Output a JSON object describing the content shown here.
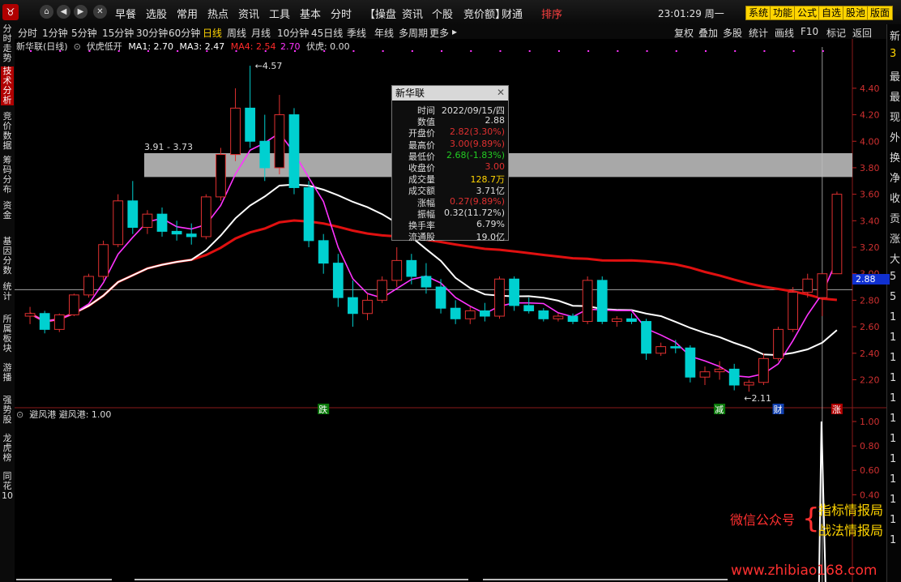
{
  "menu": {
    "items": [
      "早餐",
      "选股",
      "常用",
      "热点",
      "资讯",
      "工具",
      "基本",
      "分时",
      "【操盘",
      "资讯",
      "个股",
      "竞价额】",
      "财通",
      "排序"
    ],
    "clock": "23:01:29 周一",
    "sys_buttons": [
      "系统",
      "功能",
      "公式",
      "自选",
      "股池",
      "版面"
    ]
  },
  "periods": [
    "分时",
    "1分钟",
    "5分钟",
    "15分钟",
    "30分钟",
    "60分钟",
    "日线",
    "周线",
    "月线",
    "10分钟",
    "45日线",
    "季线",
    "年线",
    "多周期",
    "更多"
  ],
  "active_period": "日线",
  "tools": [
    "复权",
    "叠加",
    "多股",
    "统计",
    "画线",
    "F10",
    "标记",
    "返回"
  ],
  "sidebar": [
    "分时走势",
    "技术分析",
    "竞价数据",
    "筹码分布",
    "资金",
    "基因分数",
    "统计",
    "所属板块",
    "游播",
    "强势股",
    "龙虎榜",
    "同花10"
  ],
  "legend": {
    "name": "新华联(日线)",
    "indicator": "伏虎低开",
    "ma1": "MA1: 2.70",
    "ma3": "MA3: 2.47",
    "ma4": "MA4: 2.54",
    "ma4b": "2.70",
    "fuhu": "伏虎: 0.00"
  },
  "sub_legend": "避风港 避风港: 1.00",
  "tooltip": {
    "title": "新华联",
    "rows": [
      {
        "label": "时间",
        "value": "2022/09/15/四",
        "color": "#dddddd"
      },
      {
        "label": "数值",
        "value": "2.88",
        "color": "#dddddd"
      },
      {
        "label": "开盘价",
        "value": "2.82(3.30%)",
        "color": "#e03030"
      },
      {
        "label": "最高价",
        "value": "3.00(9.89%)",
        "color": "#e03030"
      },
      {
        "label": "最低价",
        "value": "2.68(-1.83%)",
        "color": "#22cc22"
      },
      {
        "label": "收盘价",
        "value": "3.00",
        "color": "#e03030"
      },
      {
        "label": "成交量",
        "value": "128.7万",
        "color": "#ffd400"
      },
      {
        "label": "成交额",
        "value": "3.71亿",
        "color": "#dddddd"
      },
      {
        "label": "涨幅",
        "value": "0.27(9.89%)",
        "color": "#e03030"
      },
      {
        "label": "振幅",
        "value": "0.32(11.72%)",
        "color": "#dddddd"
      },
      {
        "label": "换手率",
        "value": "6.79%",
        "color": "#dddddd"
      },
      {
        "label": "流通股",
        "value": "19.0亿",
        "color": "#dddddd"
      }
    ]
  },
  "annotations": {
    "high": "4.57",
    "low": "2.11",
    "zone": "3.91 - 3.73",
    "crosshair_price": "2.88",
    "marks": [
      "跌",
      "减",
      "财",
      "涨"
    ]
  },
  "watermark": {
    "line1": "微信公众号",
    "brace": "{",
    "line2a": "指标情报局",
    "line2b": "战法情报局",
    "url": "www.zhibiao168.com"
  },
  "right_strip": [
    "新",
    "3",
    "最",
    "最",
    "现",
    "外",
    "换",
    "净",
    "收",
    "贡",
    "涨",
    "大",
    "5",
    "5",
    "1",
    "1",
    "1",
    "1",
    "1",
    "1",
    "1",
    "1",
    "1",
    "1",
    "1",
    "1"
  ],
  "colors": {
    "up": "#e03030",
    "down": "#00d0d0",
    "ma_white": "#ffffff",
    "ma_magenta": "#ff33ff",
    "ma_red": "#e01010",
    "accent": "#ffd400"
  },
  "chart_data": {
    "type": "candlestick",
    "price_axis": [
      4.4,
      4.2,
      4.0,
      3.8,
      3.6,
      3.4,
      3.2,
      3.0,
      2.8,
      2.6,
      2.4,
      2.2
    ],
    "sub_axis": [
      1.0,
      0.8,
      0.6,
      0.4
    ],
    "ylim": [
      2.05,
      4.65
    ],
    "candles": [
      [
        2.68,
        2.75,
        2.62,
        2.7
      ],
      [
        2.7,
        2.72,
        2.55,
        2.58
      ],
      [
        2.58,
        2.7,
        2.56,
        2.69
      ],
      [
        2.69,
        2.85,
        2.68,
        2.84
      ],
      [
        2.84,
        3.0,
        2.82,
        2.98
      ],
      [
        2.98,
        3.25,
        2.95,
        3.22
      ],
      [
        3.22,
        3.6,
        3.2,
        3.55
      ],
      [
        3.55,
        3.7,
        3.3,
        3.35
      ],
      [
        3.35,
        3.48,
        3.3,
        3.45
      ],
      [
        3.45,
        3.5,
        3.28,
        3.32
      ],
      [
        3.32,
        3.4,
        3.25,
        3.3
      ],
      [
        3.3,
        3.38,
        3.22,
        3.28
      ],
      [
        3.28,
        3.6,
        3.26,
        3.58
      ],
      [
        3.58,
        3.95,
        3.55,
        3.9
      ],
      [
        3.9,
        4.4,
        3.85,
        4.25
      ],
      [
        4.25,
        4.57,
        3.95,
        4.0
      ],
      [
        4.0,
        4.2,
        3.7,
        3.8
      ],
      [
        3.8,
        4.35,
        3.75,
        4.2
      ],
      [
        4.2,
        4.25,
        3.6,
        3.65
      ],
      [
        3.65,
        3.7,
        3.2,
        3.25
      ],
      [
        3.25,
        3.3,
        3.0,
        3.08
      ],
      [
        3.08,
        3.15,
        2.75,
        2.82
      ],
      [
        2.82,
        2.95,
        2.6,
        2.7
      ],
      [
        2.7,
        2.85,
        2.65,
        2.8
      ],
      [
        2.8,
        2.98,
        2.78,
        2.95
      ],
      [
        2.95,
        3.2,
        2.9,
        3.1
      ],
      [
        3.1,
        3.15,
        2.92,
        2.98
      ],
      [
        2.98,
        3.08,
        2.85,
        2.9
      ],
      [
        2.9,
        2.96,
        2.7,
        2.74
      ],
      [
        2.74,
        2.8,
        2.62,
        2.66
      ],
      [
        2.66,
        2.75,
        2.62,
        2.72
      ],
      [
        2.72,
        2.78,
        2.64,
        2.68
      ],
      [
        2.68,
        2.98,
        2.66,
        2.96
      ],
      [
        2.96,
        2.98,
        2.72,
        2.76
      ],
      [
        2.76,
        2.82,
        2.7,
        2.72
      ],
      [
        2.72,
        2.74,
        2.64,
        2.66
      ],
      [
        2.66,
        2.7,
        2.64,
        2.68
      ],
      [
        2.68,
        2.7,
        2.62,
        2.64
      ],
      [
        2.64,
        2.98,
        2.62,
        2.95
      ],
      [
        2.95,
        2.98,
        2.62,
        2.64
      ],
      [
        2.64,
        2.68,
        2.6,
        2.66
      ],
      [
        2.66,
        2.7,
        2.62,
        2.64
      ],
      [
        2.64,
        2.66,
        2.35,
        2.4
      ],
      [
        2.4,
        2.48,
        2.38,
        2.45
      ],
      [
        2.45,
        2.5,
        2.4,
        2.44
      ],
      [
        2.44,
        2.46,
        2.18,
        2.22
      ],
      [
        2.22,
        2.3,
        2.16,
        2.26
      ],
      [
        2.26,
        2.34,
        2.2,
        2.28
      ],
      [
        2.28,
        2.32,
        2.12,
        2.16
      ],
      [
        2.16,
        2.2,
        2.11,
        2.18
      ],
      [
        2.18,
        2.4,
        2.16,
        2.36
      ],
      [
        2.36,
        2.6,
        2.34,
        2.58
      ],
      [
        2.58,
        2.9,
        2.56,
        2.86
      ],
      [
        2.86,
        3.0,
        2.82,
        2.96
      ],
      [
        2.82,
        3.0,
        2.68,
        3.0
      ],
      [
        3.0,
        3.62,
        3.0,
        3.6
      ]
    ]
  }
}
